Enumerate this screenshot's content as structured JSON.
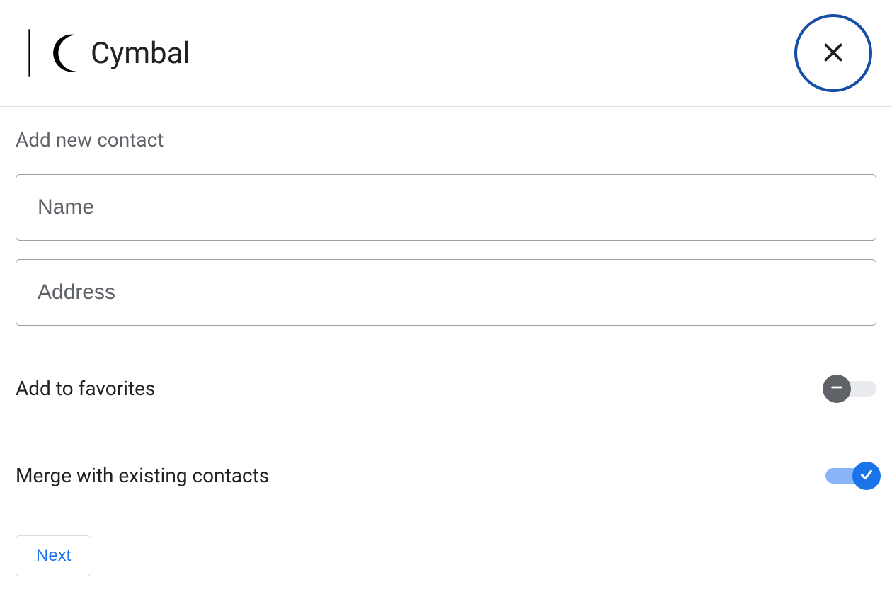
{
  "header": {
    "brand_name": "Cymbal"
  },
  "form": {
    "title": "Add new contact",
    "name_placeholder": "Name",
    "name_value": "",
    "address_placeholder": "Address",
    "address_value": "",
    "favorites_label": "Add to favorites",
    "favorites_enabled": false,
    "merge_label": "Merge with existing contacts",
    "merge_enabled": true,
    "next_label": "Next"
  },
  "colors": {
    "primary_blue": "#1a73e8",
    "close_border": "#174ea6",
    "text_gray": "#5f6368",
    "track_off": "#e8eaed",
    "track_on": "#8ab4f8"
  }
}
